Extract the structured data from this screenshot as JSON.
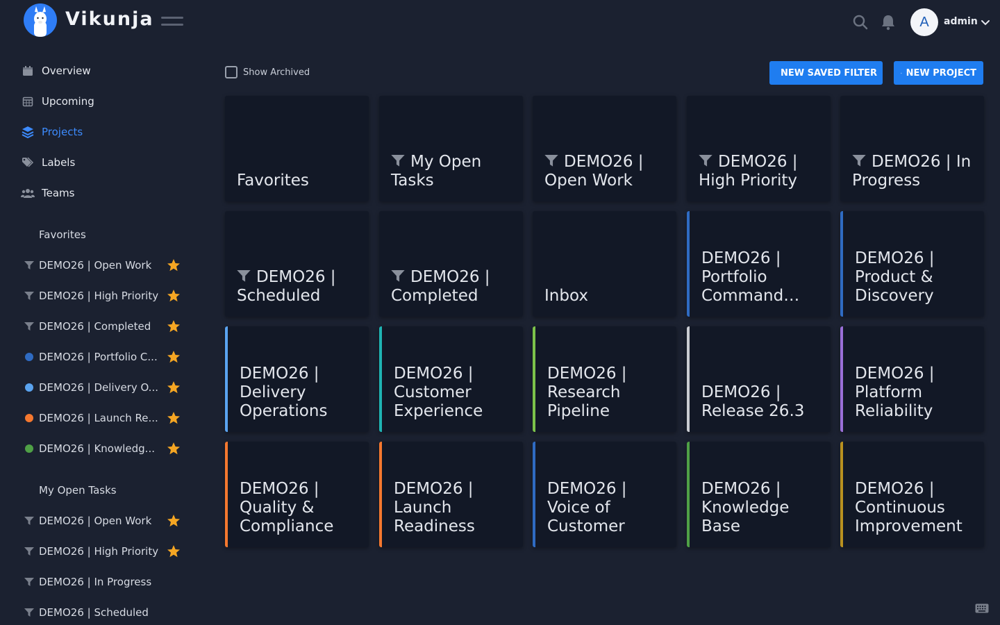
{
  "app": {
    "name": "Vikunja",
    "user_initial": "A",
    "username": "admin"
  },
  "nav": [
    {
      "label": "Overview",
      "icon": "calendar-icon",
      "active": false
    },
    {
      "label": "Upcoming",
      "icon": "calendar-grid-icon",
      "active": false
    },
    {
      "label": "Projects",
      "icon": "layers-icon",
      "active": true
    },
    {
      "label": "Labels",
      "icon": "tags-icon",
      "active": false
    },
    {
      "label": "Teams",
      "icon": "users-icon",
      "active": false
    }
  ],
  "sidebar": {
    "favorites_heading": "Favorites",
    "favorites": [
      {
        "label": "DEMO26 | Open Work",
        "type": "filter"
      },
      {
        "label": "DEMO26 | High Priority",
        "type": "filter"
      },
      {
        "label": "DEMO26 | Completed",
        "type": "filter"
      },
      {
        "label": "DEMO26 | Portfolio C...",
        "type": "dot",
        "color": "#2f6bc2"
      },
      {
        "label": "DEMO26 | Delivery O...",
        "type": "dot",
        "color": "#5aa3ef"
      },
      {
        "label": "DEMO26 | Launch Re...",
        "type": "dot",
        "color": "#f5782f"
      },
      {
        "label": "DEMO26 | Knowledg...",
        "type": "dot",
        "color": "#4fa046"
      }
    ],
    "filters_heading": "My Open Tasks",
    "filters": [
      {
        "label": "DEMO26 | Open Work",
        "starred": true
      },
      {
        "label": "DEMO26 | High Priority",
        "starred": true
      },
      {
        "label": "DEMO26 | In Progress",
        "starred": false
      },
      {
        "label": "DEMO26 | Scheduled",
        "starred": false
      }
    ]
  },
  "toolbar": {
    "show_archived": "Show Archived",
    "new_saved_filter": "NEW SAVED FILTER",
    "new_project": "NEW PROJECT"
  },
  "colors": {
    "accent": "#1f7df0",
    "star": "#f5a623",
    "background": "#1b2130",
    "card": "#121826"
  },
  "projects": [
    {
      "title": "Favorites",
      "filter": false,
      "color": null
    },
    {
      "title": "My Open Tasks",
      "filter": true,
      "color": null
    },
    {
      "title": "DEMO26 | Open Work",
      "filter": true,
      "color": null
    },
    {
      "title": "DEMO26 | High Priority",
      "filter": true,
      "color": null
    },
    {
      "title": "DEMO26 | In Progress",
      "filter": true,
      "color": null
    },
    {
      "title": "DEMO26 | Scheduled",
      "filter": true,
      "color": null
    },
    {
      "title": "DEMO26 | Completed",
      "filter": true,
      "color": null
    },
    {
      "title": "Inbox",
      "filter": false,
      "color": null
    },
    {
      "title": "DEMO26 | Portfolio Command…",
      "filter": false,
      "color": "#2f6bc2"
    },
    {
      "title": "DEMO26 | Product & Discovery",
      "filter": false,
      "color": "#2f6bc2"
    },
    {
      "title": "DEMO26 | Delivery Operations",
      "filter": false,
      "color": "#5aa3ef"
    },
    {
      "title": "DEMO26 | Customer Experience",
      "filter": false,
      "color": "#1fb3b3"
    },
    {
      "title": "DEMO26 | Research Pipeline",
      "filter": false,
      "color": "#7cc24a"
    },
    {
      "title": "DEMO26 | Release 26.3",
      "filter": false,
      "color": "#c9ccd2"
    },
    {
      "title": "DEMO26 | Platform Reliability",
      "filter": false,
      "color": "#9a6fd8"
    },
    {
      "title": "DEMO26 | Quality & Compliance",
      "filter": false,
      "color": "#f5782f"
    },
    {
      "title": "DEMO26 | Launch Readiness",
      "filter": false,
      "color": "#f5782f"
    },
    {
      "title": "DEMO26 | Voice of Customer",
      "filter": false,
      "color": "#2f6bc2"
    },
    {
      "title": "DEMO26 | Knowledge Base",
      "filter": false,
      "color": "#4fa046"
    },
    {
      "title": "DEMO26 | Continuous Improvement",
      "filter": false,
      "color": "#b8901f"
    }
  ]
}
